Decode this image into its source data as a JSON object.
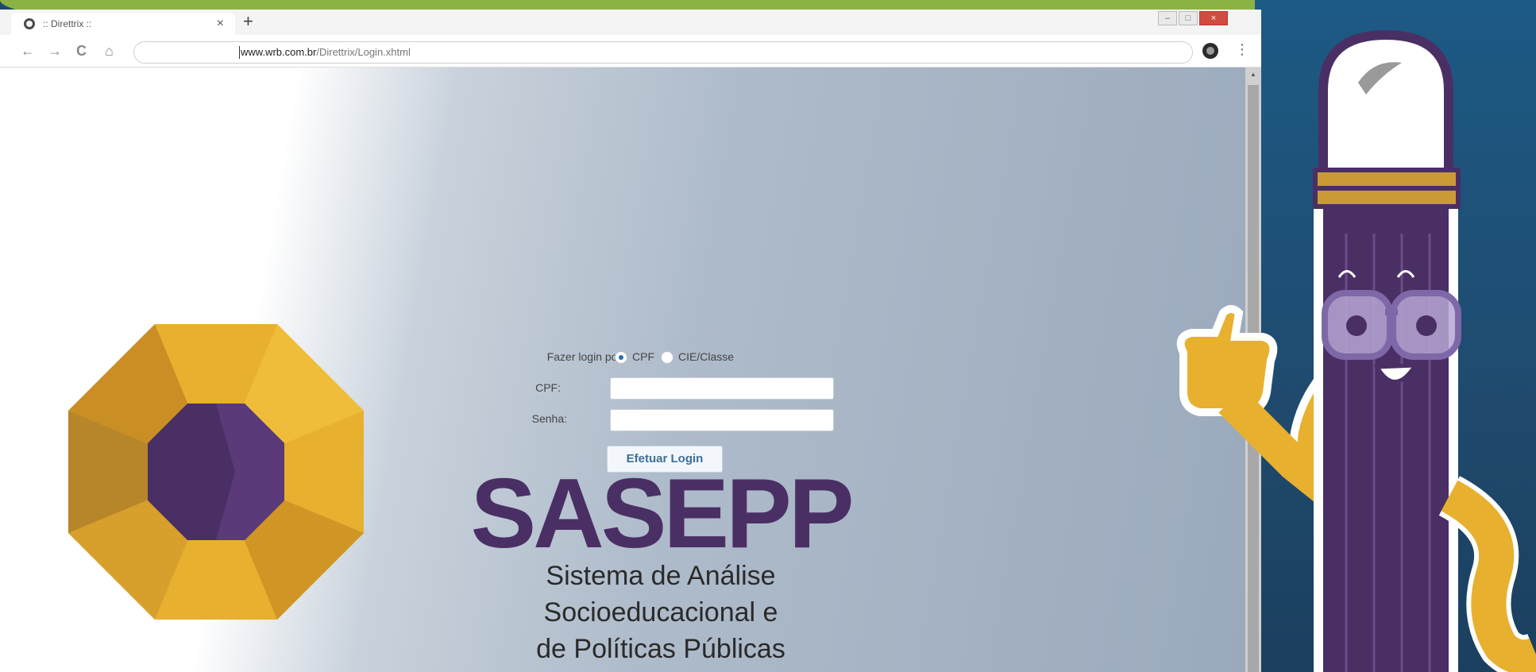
{
  "browser": {
    "tab_title": ":: Direttrix ::",
    "tab_close": "×",
    "new_tab": "+",
    "url_domain": "www.wrb.com.br",
    "url_path": "/Direttrix/Login.xhtml",
    "nav": {
      "back": "←",
      "forward": "→",
      "reload": "C",
      "home": "⌂",
      "star": "☆",
      "menu": "⋮"
    }
  },
  "login": {
    "login_by_label": "Fazer login por:",
    "option_cpf": "CPF",
    "option_cie": "CIE/Classe",
    "selected_option": "CPF",
    "cpf_label": "CPF:",
    "cpf_value": "",
    "password_label": "Senha:",
    "password_value": "",
    "submit_label": "Efetuar Login"
  },
  "brand": {
    "name": "SASEPP",
    "subtitle_line1": "Sistema de Análise",
    "subtitle_line2": "Socioeducacional e",
    "subtitle_line3": "de Políticas Públicas"
  },
  "graphics": {
    "emblem": "octagon-emblem-icon",
    "mascot": "pencil-mascot-thumbs-up-icon"
  },
  "colors": {
    "brand_purple": "#4a2f65",
    "emblem_gold": "#e8b02f",
    "background_blue": "#1f4a6e",
    "top_band_green": "#8bb343"
  }
}
